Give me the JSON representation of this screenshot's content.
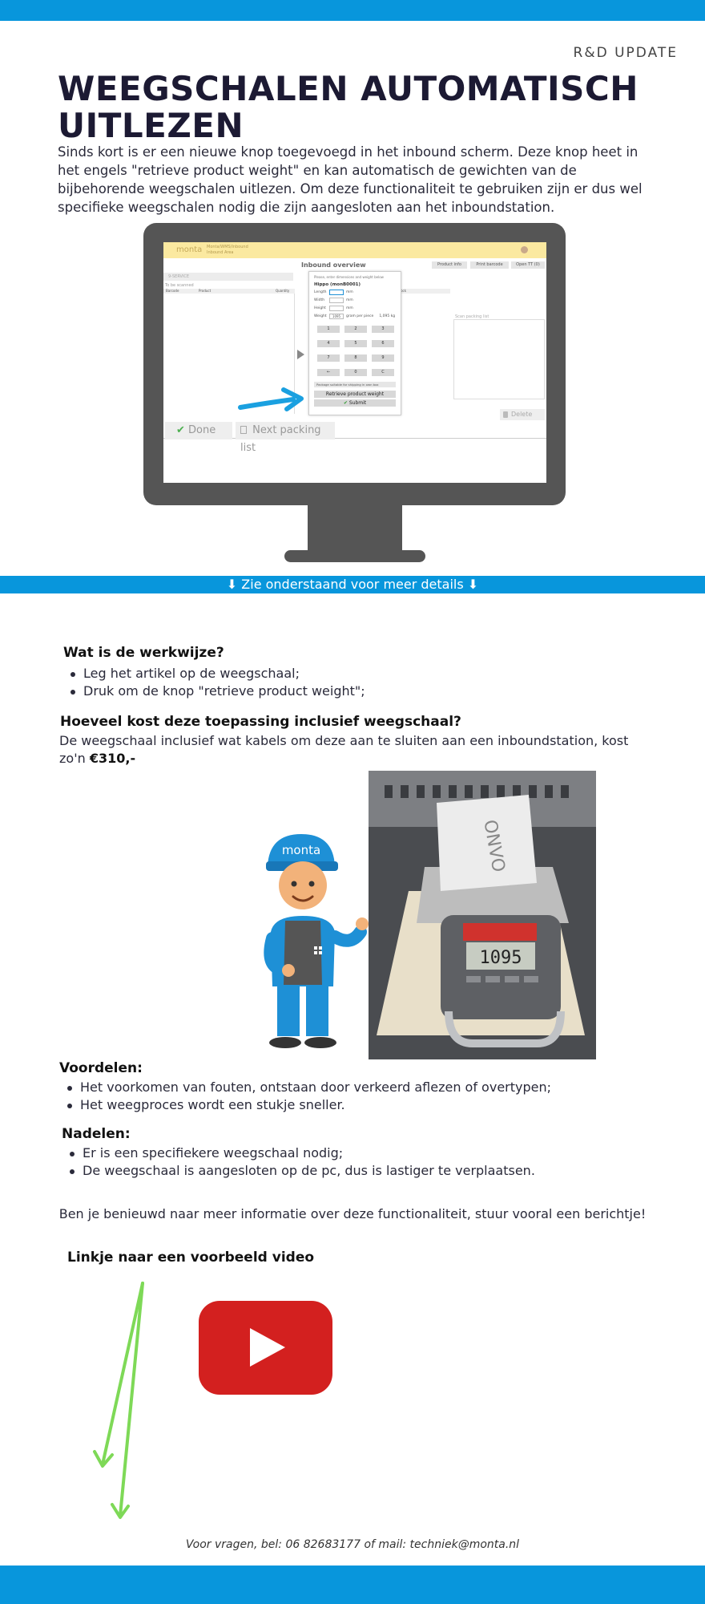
{
  "header": {
    "kicker": "R&D UPDATE",
    "title": "WEEGSCHALEN AUTOMATISCH UITLEZEN",
    "intro": "Sinds kort is er een nieuwe knop toegevoegd in het inbound scherm. Deze knop heet in het engels \"retrieve product weight\" en kan automatisch de gewichten van de bijbehorende weegschalen uitlezen. Om deze functionaliteit te gebruiken zijn er dus wel specifieke weegschalen nodig die zijn aangesloten aan het inboundstation."
  },
  "screen": {
    "logo": "monta",
    "app_title_line1": "Monta/WMS/Inbound",
    "app_title_line2": "Inbound Area",
    "product_info_btn": "Product info",
    "print_barcode_btn": "Print barcode",
    "open_btn": "Open TT (0)",
    "overview_title": "Inbound overview",
    "search_placeholder": "9-SERVICE",
    "to_be_scanned_label": "To be scanned",
    "col_barcode": "Barcode",
    "col_product": "Product",
    "col_quantity": "Quantity",
    "col_stock": "Stock",
    "scan_packing_list_label": "Scan packing list",
    "dialog": {
      "prompt": "Please, enter dimensions and weight below",
      "product_name": "Hippo (monB0001)",
      "length_label": "Length",
      "width_label": "Width",
      "height_label": "Height",
      "weight_label": "Weight",
      "unit_mm": "mm",
      "weight_value": "1095",
      "weight_unit_text": "gram per piece",
      "weight_kg": "1,095 kg",
      "keys": [
        "1",
        "2",
        "3",
        "4",
        "5",
        "6",
        "7",
        "8",
        "9",
        "←",
        "0",
        "C"
      ],
      "checkbox_label": "Package suitable for shipping in own box",
      "retrieve_btn": "Retrieve product weight",
      "submit_btn": "Submit"
    },
    "delete_btn": "Delete",
    "done_btn": "Done",
    "next_packing_btn": "Next packing list"
  },
  "cta_bar": {
    "text": "⬇ Zie onderstaand voor meer details ⬇"
  },
  "werkwijze": {
    "heading": "Wat is de werkwijze?",
    "items": [
      "Leg het artikel op de weegschaal;",
      "Druk om de knop \"retrieve product weight\";"
    ]
  },
  "kosten": {
    "heading": "Hoeveel kost deze toepassing inclusief weegschaal?",
    "text": "De weegschaal inclusief wat kabels om deze aan te sluiten aan een inboundstation, kost zo'n",
    "price": "€310,-"
  },
  "illustration": {
    "cap_text": "monta",
    "scale_display": "1095",
    "box_text": "ONVO"
  },
  "voordelen": {
    "heading": "Voordelen:",
    "items": [
      "Het voorkomen van fouten, ontstaan door verkeerd aflezen of overtypen;",
      "Het weegproces wordt een stukje sneller."
    ]
  },
  "nadelen": {
    "heading": "Nadelen:",
    "items": [
      "Er is een specifiekere weegschaal nodig;",
      "De weegschaal is aangesloten op de pc, dus is lastiger te verplaatsen."
    ]
  },
  "info_text": "Ben je benieuwd naar meer informatie over deze functionaliteit, stuur vooral een berichtje!",
  "video": {
    "heading": "Linkje naar een voorbeeld video"
  },
  "footer": {
    "contact": "Voor vragen, bel: 06 82683177 of mail: techniek@monta.nl"
  },
  "colors": {
    "brand_blue": "#0896dc",
    "title_navy": "#1c1a33",
    "youtube_red": "#d3201f",
    "arrow_green": "#7ed957",
    "monitor_gray": "#555555"
  }
}
